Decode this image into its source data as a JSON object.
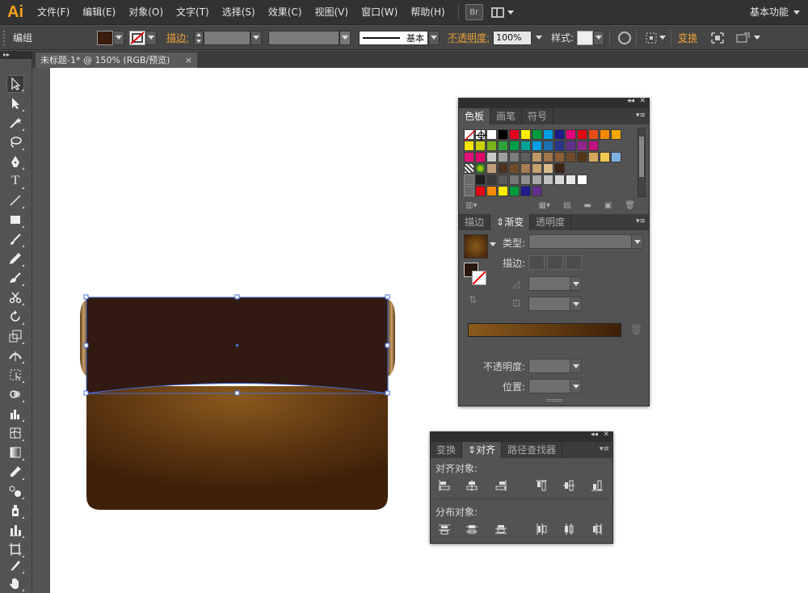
{
  "app": {
    "logo": "Ai",
    "workspace": "基本功能"
  },
  "menu": [
    "文件(F)",
    "编辑(E)",
    "对象(O)",
    "文字(T)",
    "选择(S)",
    "效果(C)",
    "视图(V)",
    "窗口(W)",
    "帮助(H)"
  ],
  "menu_extra": {
    "bridge": "Br"
  },
  "control": {
    "selection": "编组",
    "stroke_label": "描边:",
    "stroke_style_label": "基本",
    "opacity_label": "不透明度:",
    "opacity_value": "100%",
    "style_label": "样式:",
    "transform_label": "变换"
  },
  "document": {
    "tab_title": "未标题-1* @ 150% (RGB/预览)",
    "close": "×"
  },
  "swatches_panel": {
    "tabs": [
      "色板",
      "画笔",
      "符号"
    ],
    "active_tab": "色板"
  },
  "gradient_panel": {
    "tabs": [
      "描边",
      "渐变",
      "透明度"
    ],
    "active_tab": "渐变",
    "type_label": "类型:",
    "stroke_label": "描边:",
    "opacity_label": "不透明度:",
    "position_label": "位置:"
  },
  "align_panel": {
    "tabs": [
      "变换",
      "对齐",
      "路径查找器"
    ],
    "active_tab": "对齐",
    "align_objects": "对齐对象:",
    "distribute_objects": "分布对象:"
  },
  "colors": {
    "accent_orange": "#f7a11a",
    "shape_top_fill": "#301a11",
    "shape_bottom_center": "#8a5a1c",
    "shape_bottom_edge": "#3e2008",
    "selection_blue": "#4a6fd4"
  }
}
